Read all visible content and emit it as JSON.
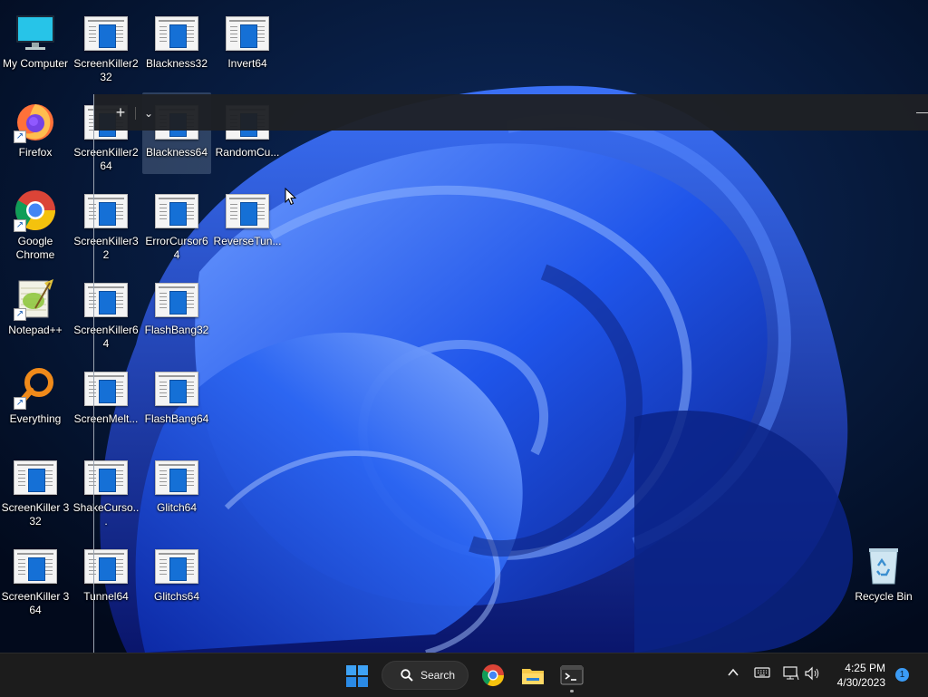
{
  "desktop": {
    "icons": [
      {
        "label": "My Computer",
        "type": "computer"
      },
      {
        "label": "ScreenKiller2 32",
        "type": "exe"
      },
      {
        "label": "Blackness32",
        "type": "exe"
      },
      {
        "label": "Invert64",
        "type": "exe"
      },
      {
        "label": "Firefox",
        "type": "firefox"
      },
      {
        "label": "ScreenKiller2 64",
        "type": "exe"
      },
      {
        "label": "Blackness64",
        "type": "exe",
        "selected": true
      },
      {
        "label": "RandomCu...",
        "type": "exe"
      },
      {
        "label": "Google Chrome",
        "type": "chrome"
      },
      {
        "label": "ScreenKiller32",
        "type": "exe"
      },
      {
        "label": "ErrorCursor64",
        "type": "exe"
      },
      {
        "label": "ReverseTun...",
        "type": "exe"
      },
      {
        "label": "Notepad++",
        "type": "notepadpp"
      },
      {
        "label": "ScreenKiller64",
        "type": "exe"
      },
      {
        "label": "FlashBang32",
        "type": "exe"
      },
      {
        "label": "Everything",
        "type": "everything"
      },
      {
        "label": "ScreenMelt...",
        "type": "exe"
      },
      {
        "label": "FlashBang64",
        "type": "exe"
      },
      {
        "label": "ScreenKiller 3 32",
        "type": "exe"
      },
      {
        "label": "ShakeCurso...",
        "type": "exe"
      },
      {
        "label": "Glitch64",
        "type": "exe"
      },
      {
        "label": "ScreenKiller 3 64",
        "type": "exe"
      },
      {
        "label": "Tunnel64",
        "type": "exe"
      },
      {
        "label": "Glitchs64",
        "type": "exe"
      },
      {
        "label": "Recycle Bin",
        "type": "recycle"
      }
    ]
  },
  "terminal": {
    "new_tab_glyph": "+",
    "dropdown_glyph": "⌄",
    "minimize_glyph": "—"
  },
  "taskbar": {
    "search_label": "Search",
    "clock_time": "4:25 PM",
    "clock_date": "4/30/2023",
    "notification_count": "1",
    "icons": [
      "windows-logo-icon",
      "search-icon",
      "chrome-icon",
      "file-explorer-icon",
      "terminal-icon",
      "chevron-up-icon",
      "keyboard-icon",
      "network-icon",
      "speaker-icon"
    ]
  },
  "colors": {
    "wallpaper_bg": "#04132e",
    "wallpaper_bloom": "#1d56e8",
    "taskbar_bg": "#1c1c1c",
    "exe_blue": "#1570d6",
    "accent": "#3b9bf5"
  }
}
